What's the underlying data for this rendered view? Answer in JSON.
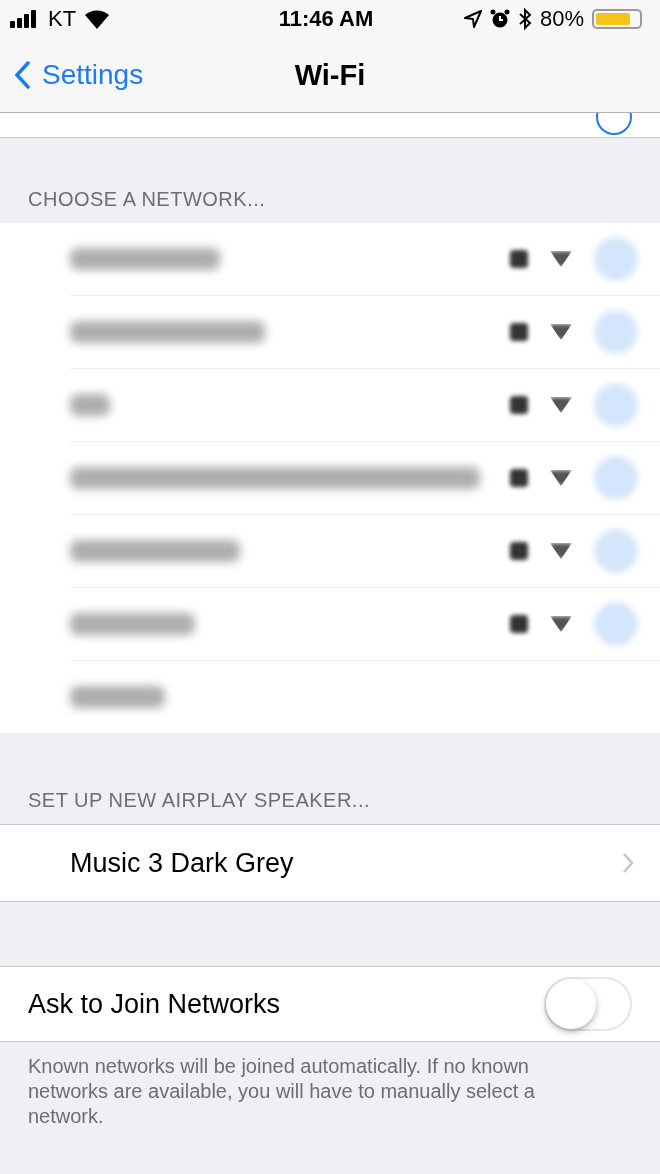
{
  "status_bar": {
    "carrier": "KT",
    "time": "11:46 AM",
    "battery": "80%",
    "battery_icon": {
      "level": 0.8
    }
  },
  "nav": {
    "back": "Settings",
    "title": "Wi-Fi"
  },
  "networks_header": "CHOOSE A NETWORK...",
  "networks": [
    {
      "kind": "network",
      "locked": true
    },
    {
      "kind": "network",
      "locked": true
    },
    {
      "kind": "network",
      "locked": true
    },
    {
      "kind": "network",
      "locked": true
    },
    {
      "kind": "network",
      "locked": true
    },
    {
      "kind": "network",
      "locked": true
    },
    {
      "kind": "other"
    }
  ],
  "airplay_header": "SET UP NEW AIRPLAY SPEAKER...",
  "airplay_items": [
    {
      "label": "Music 3 Dark Grey"
    }
  ],
  "ask_to_join": {
    "label": "Ask to Join Networks",
    "on": false
  },
  "footer": "Known networks will be joined automatically. If no known networks are available, you will have to manually select a network."
}
